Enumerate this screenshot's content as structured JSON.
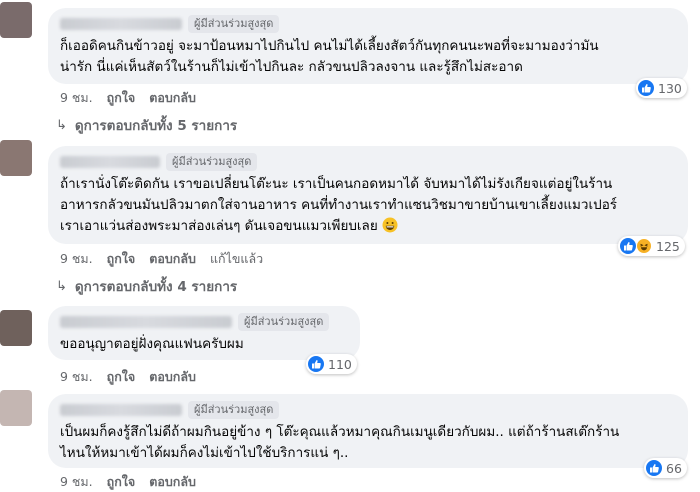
{
  "badge_label": "ผู้มีส่วนร่วมสูงสุด",
  "comments": [
    {
      "text": "ก็เออดิคนกินข้าวอยู่ จะมาป้อนหมาไปกินไป คนไม่ได้เลี้ยงสัตว์กันทุกคนนะพอที่จะมามองว่ามัน\nน่ารัก นี่แค่เห็นสัตว์ในร้านก็ไม่เข้าไปกินละ กลัวขนปลิวลงจาน และรู้สึกไม่สะอาด",
      "time": "9 ชม.",
      "like": "ถูกใจ",
      "reply": "ตอบกลับ",
      "reaction_count": "130",
      "replies_label": "ดูการตอบกลับทั้ง 5 รายการ"
    },
    {
      "text": "ถ้าเรานั่งโต๊ะติดกัน เราขอเปลี่ยนโต๊ะนะ เราเป็นคนกอดหมาได้ จับหมาได้ไม่รังเกียจแต่อยู่ในร้าน\nอาหารกลัวขนมันปลิวมาตกใส่จานอาหาร คนที่ทำงานเราทำแซนวิชมาขายบ้านเขาเลี้ยงแมวเปอร์\nเราเอาแว่นส่องพระมาส่องเล่นๆ ดันเจอขนแมวเพียบเลย",
      "time": "9 ชม.",
      "like": "ถูกใจ",
      "reply": "ตอบกลับ",
      "edited": "แก้ไขแล้ว",
      "reaction_count": "125",
      "replies_label": "ดูการตอบกลับทั้ง 4 รายการ"
    },
    {
      "text": "ขออนุญาตอยู่ฝั่งคุณแฟนครับผม",
      "time": "9 ชม.",
      "like": "ถูกใจ",
      "reply": "ตอบกลับ",
      "reaction_count": "110"
    },
    {
      "text": "เป็นผมก็คงรู้สึกไม่ดีถ้าผมกินอยู่ข้าง ๆ โต๊ะคุณแล้วหมาคุณกินเมนูเดียวกับผม.. แต่ถ้าร้านสเต๊กร้าน\nไหนให้หมาเข้าได้ผมก็คงไม่เข้าไปใช้บริการแน่ ๆ..",
      "time": "9 ชม.",
      "like": "ถูกใจ",
      "reply": "ตอบกลับ",
      "reaction_count": "66"
    }
  ],
  "colors": {
    "like_blue": "#1877f2",
    "bubble_bg": "#f0f2f5",
    "meta_gray": "#65676b"
  },
  "icons": {
    "reaction_like": "like-icon",
    "reaction_haha": "haha-icon",
    "reply_arrow": "reply-arrow-icon",
    "grin_emoji": "grinning-emoji"
  }
}
